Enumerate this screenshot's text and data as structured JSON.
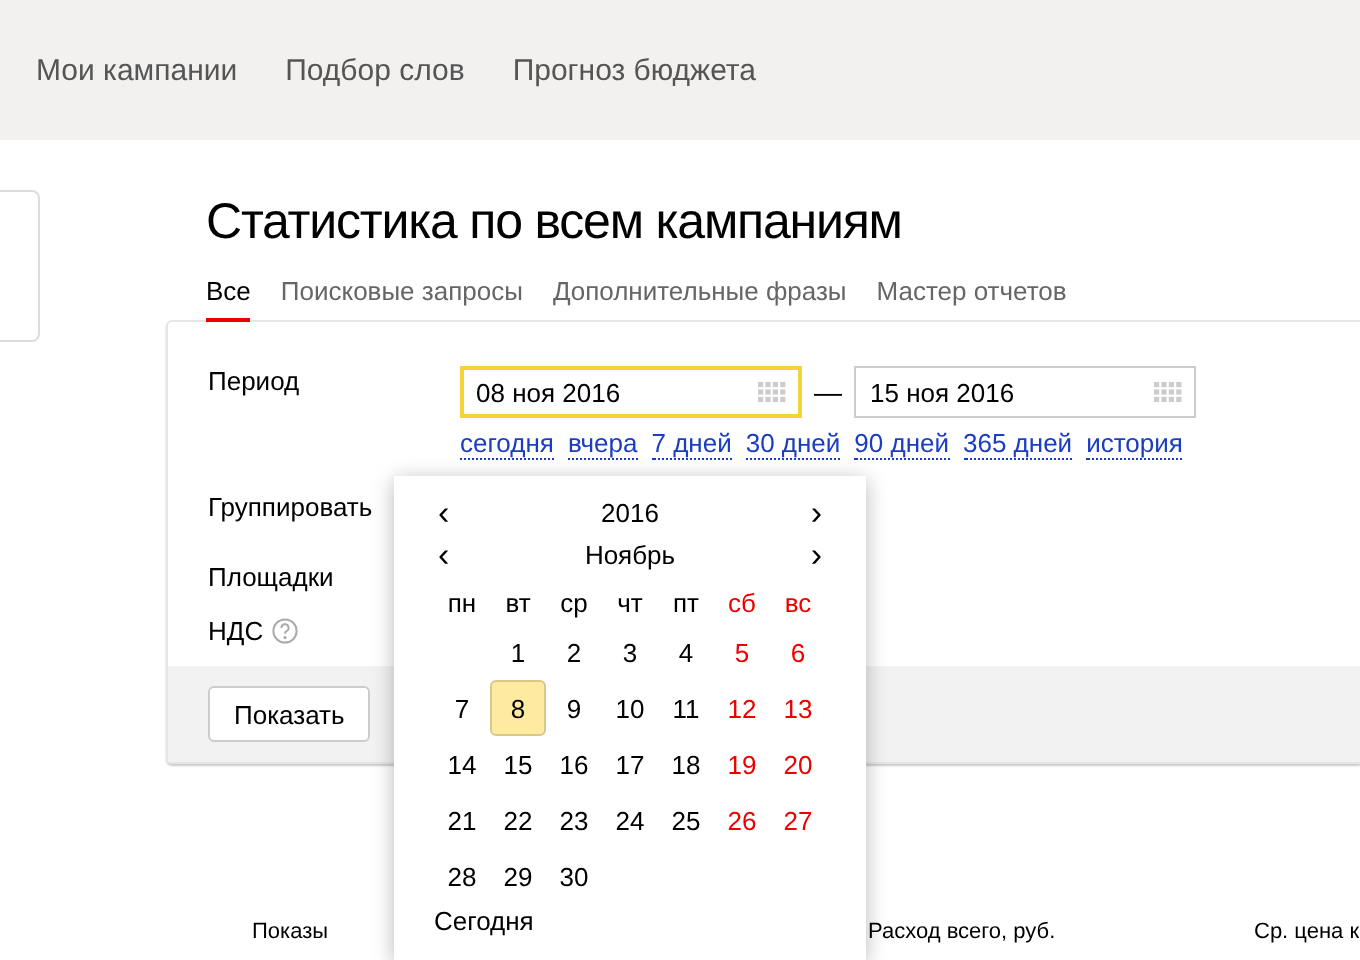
{
  "nav": [
    {
      "label": "Мои кампании"
    },
    {
      "label": "Подбор слов"
    },
    {
      "label": "Прогноз бюджета"
    }
  ],
  "title": "Статистика по всем кампаниям",
  "tabs": [
    {
      "label": "Все",
      "selected": true
    },
    {
      "label": "Поисковые запросы",
      "selected": false
    },
    {
      "label": "Дополнительные фразы",
      "selected": false
    },
    {
      "label": "Мастер отчетов",
      "selected": false
    }
  ],
  "form": {
    "period_label": "Период",
    "date_fields": [
      {
        "value": "08 ноя 2016",
        "focused": true
      },
      {
        "value": "15 ноя 2016",
        "focused": false
      }
    ],
    "separator": "—",
    "quick_links": [
      "сегодня",
      "вчера",
      "7 дней",
      "30 дней",
      "90 дней",
      "365 дней",
      "история"
    ],
    "labels": [
      "Группировать",
      "Площадки",
      "НДС"
    ],
    "submit": "Показать"
  },
  "calendar": {
    "prev": "‹",
    "next": "›",
    "year": "2016",
    "month": "Ноябрь",
    "weekdays": [
      {
        "label": "пн",
        "weekend": false
      },
      {
        "label": "вт",
        "weekend": false
      },
      {
        "label": "ср",
        "weekend": false
      },
      {
        "label": "чт",
        "weekend": false
      },
      {
        "label": "пт",
        "weekend": false
      },
      {
        "label": "сб",
        "weekend": true
      },
      {
        "label": "вс",
        "weekend": true
      }
    ],
    "weeks": [
      [
        {
          "day": "1",
          "selected": false
        },
        {
          "day": "2",
          "selected": false
        },
        {
          "day": "3",
          "selected": false
        },
        {
          "day": "4",
          "selected": false
        },
        {
          "day": "5",
          "selected": false
        },
        {
          "day": "6",
          "selected": false
        }
      ],
      [
        {
          "day": "7",
          "selected": false
        },
        {
          "day": "8",
          "selected": true
        },
        {
          "day": "9",
          "selected": false
        },
        {
          "day": "10",
          "selected": false
        },
        {
          "day": "11",
          "selected": false
        },
        {
          "day": "12",
          "selected": false
        },
        {
          "day": "13",
          "selected": false
        }
      ],
      [
        {
          "day": "14",
          "selected": false
        },
        {
          "day": "15",
          "selected": false
        },
        {
          "day": "16",
          "selected": false
        },
        {
          "day": "17",
          "selected": false
        },
        {
          "day": "18",
          "selected": false
        },
        {
          "day": "19",
          "selected": false
        },
        {
          "day": "20",
          "selected": false
        }
      ],
      [
        {
          "day": "21",
          "selected": false
        },
        {
          "day": "22",
          "selected": false
        },
        {
          "day": "23",
          "selected": false
        },
        {
          "day": "24",
          "selected": false
        },
        {
          "day": "25",
          "selected": false
        },
        {
          "day": "26",
          "selected": false
        },
        {
          "day": "27",
          "selected": false
        }
      ],
      [
        {
          "day": "28",
          "selected": false
        },
        {
          "day": "29",
          "selected": false
        },
        {
          "day": "30",
          "selected": false
        }
      ]
    ],
    "today": "Сегодня"
  },
  "table": {
    "columns": [
      "Показы",
      "Расход всего, руб.",
      "Ср. цена к"
    ]
  }
}
